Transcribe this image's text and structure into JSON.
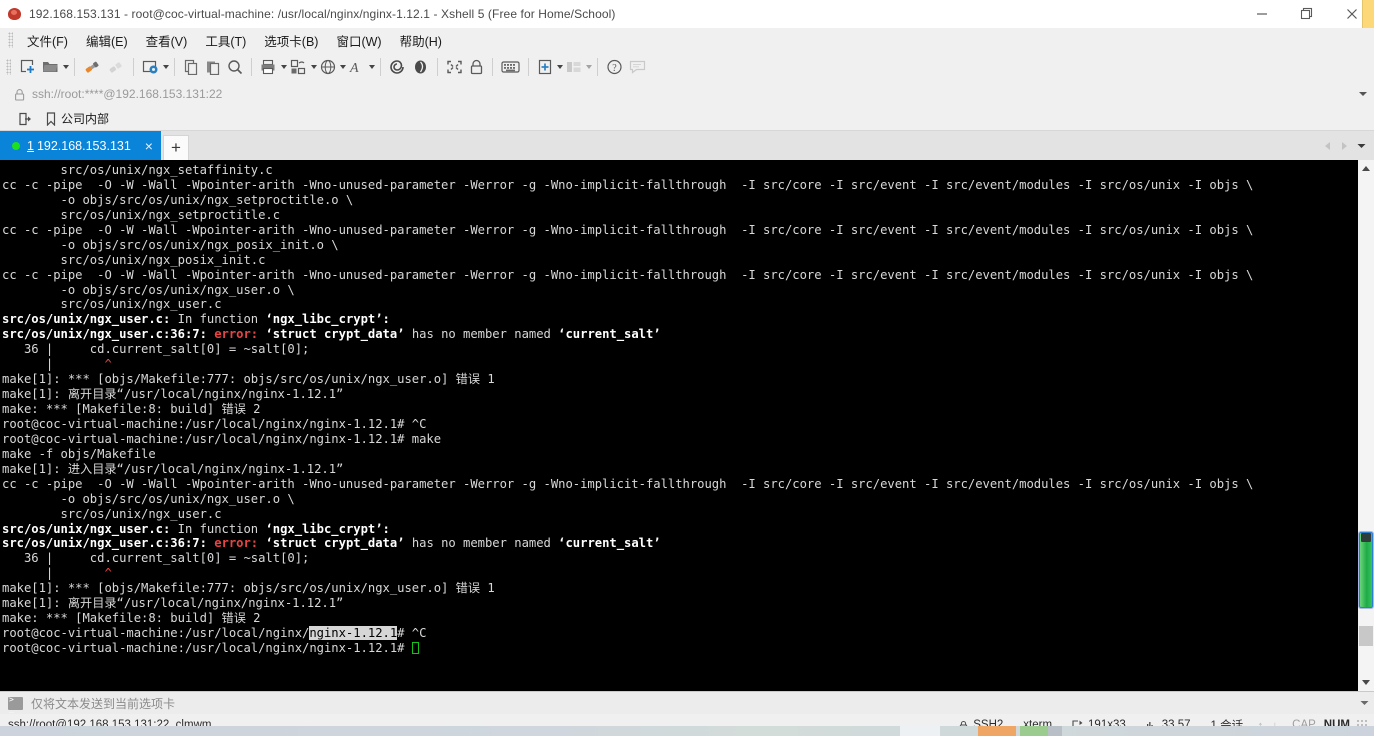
{
  "window": {
    "title": "192.168.153.131 - root@coc-virtual-machine: /usr/local/nginx/nginx-1.12.1 - Xshell 5 (Free for Home/School)",
    "minimize_label": "minimize",
    "restore_label": "restore",
    "close_label": "close"
  },
  "menubar": {
    "items": [
      {
        "label": "文件(F)",
        "name": "menu-file"
      },
      {
        "label": "编辑(E)",
        "name": "menu-edit"
      },
      {
        "label": "查看(V)",
        "name": "menu-view"
      },
      {
        "label": "工具(T)",
        "name": "menu-tools"
      },
      {
        "label": "选项卡(B)",
        "name": "menu-tab"
      },
      {
        "label": "窗口(W)",
        "name": "menu-window"
      },
      {
        "label": "帮助(H)",
        "name": "menu-help"
      }
    ]
  },
  "toolbar": {
    "icons": [
      "new-session-icon",
      "open-folder-icon",
      "connect-icon",
      "disconnect-icon",
      "session-properties-icon",
      "copy-icon",
      "paste-icon",
      "find-icon",
      "print-icon",
      "transfer-icon",
      "globe-icon",
      "font-icon",
      "log-icon",
      "compose-icon",
      "fullscreen-icon",
      "lock-icon",
      "keyboard-icon",
      "add-layout-icon",
      "arrange-icon",
      "help-icon",
      "chat-icon"
    ]
  },
  "address": {
    "value": "ssh://root:****@192.168.153.131:22",
    "lock_icon": "lock-icon",
    "dropdown_icon": "chevron-down-icon"
  },
  "bookmarks": {
    "export_icon": "export-icon",
    "bookmark_icon": "bookmark-icon",
    "label": "公司内部"
  },
  "tabs": {
    "items": [
      {
        "index": "1",
        "label": "192.168.153.131",
        "status": "connected",
        "close": "×"
      }
    ],
    "new_tab_label": "+",
    "nav_prev": "prev-tab",
    "nav_next": "next-tab",
    "nav_list": "tab-list"
  },
  "terminal": {
    "cursor_glyph": "",
    "lines": [
      [
        {
          "t": "        src/os/unix/ngx_setaffinity.c"
        }
      ],
      [
        {
          "t": "cc -c -pipe  -O -W -Wall -Wpointer-arith -Wno-unused-parameter -Werror -g -Wno-implicit-fallthrough  -I src/core -I src/event -I src/event/modules -I src/os/unix -I objs \\"
        }
      ],
      [
        {
          "t": "        -o objs/src/os/unix/ngx_setproctitle.o \\"
        }
      ],
      [
        {
          "t": "        src/os/unix/ngx_setproctitle.c"
        }
      ],
      [
        {
          "t": "cc -c -pipe  -O -W -Wall -Wpointer-arith -Wno-unused-parameter -Werror -g -Wno-implicit-fallthrough  -I src/core -I src/event -I src/event/modules -I src/os/unix -I objs \\"
        }
      ],
      [
        {
          "t": "        -o objs/src/os/unix/ngx_posix_init.o \\"
        }
      ],
      [
        {
          "t": "        src/os/unix/ngx_posix_init.c"
        }
      ],
      [
        {
          "t": "cc -c -pipe  -O -W -Wall -Wpointer-arith -Wno-unused-parameter -Werror -g -Wno-implicit-fallthrough  -I src/core -I src/event -I src/event/modules -I src/os/unix -I objs \\"
        }
      ],
      [
        {
          "t": "        -o objs/src/os/unix/ngx_user.o \\"
        }
      ],
      [
        {
          "t": "        src/os/unix/ngx_user.c"
        }
      ],
      [
        {
          "t": "src/os/unix/ngx_user.c:",
          "c": "b"
        },
        {
          "t": " In function "
        },
        {
          "t": "‘ngx_libc_crypt’:",
          "c": "b"
        }
      ],
      [
        {
          "t": "src/os/unix/ngx_user.c:36:7: ",
          "c": "b"
        },
        {
          "t": "error:",
          "c": "red"
        },
        {
          "t": " "
        },
        {
          "t": "‘struct crypt_data’",
          "c": "b"
        },
        {
          "t": " has no member named "
        },
        {
          "t": "‘current_salt’",
          "c": "b"
        }
      ],
      [
        {
          "t": "   36 |     cd.current_salt[0] = ~salt[0];"
        }
      ],
      [
        {
          "t": "      |       "
        },
        {
          "t": "^",
          "c": "redcaret"
        }
      ],
      [
        {
          "t": "make[1]: *** [objs/Makefile:777: objs/src/os/unix/ngx_user.o] 错误 1"
        }
      ],
      [
        {
          "t": "make[1]: 离开目录“/usr/local/nginx/nginx-1.12.1”"
        }
      ],
      [
        {
          "t": "make: *** [Makefile:8: build] 错误 2"
        }
      ],
      [
        {
          "t": "root@coc-virtual-machine:/usr/local/nginx/nginx-1.12.1# ^C"
        }
      ],
      [
        {
          "t": "root@coc-virtual-machine:/usr/local/nginx/nginx-1.12.1# make"
        }
      ],
      [
        {
          "t": "make -f objs/Makefile"
        }
      ],
      [
        {
          "t": "make[1]: 进入目录“/usr/local/nginx/nginx-1.12.1”"
        }
      ],
      [
        {
          "t": "cc -c -pipe  -O -W -Wall -Wpointer-arith -Wno-unused-parameter -Werror -g -Wno-implicit-fallthrough  -I src/core -I src/event -I src/event/modules -I src/os/unix -I objs \\"
        }
      ],
      [
        {
          "t": "        -o objs/src/os/unix/ngx_user.o \\"
        }
      ],
      [
        {
          "t": "        src/os/unix/ngx_user.c"
        }
      ],
      [
        {
          "t": "src/os/unix/ngx_user.c:",
          "c": "b"
        },
        {
          "t": " In function "
        },
        {
          "t": "‘ngx_libc_crypt’:",
          "c": "b"
        }
      ],
      [
        {
          "t": "src/os/unix/ngx_user.c:36:7: ",
          "c": "b"
        },
        {
          "t": "error:",
          "c": "red"
        },
        {
          "t": " "
        },
        {
          "t": "‘struct crypt_data’",
          "c": "b"
        },
        {
          "t": " has no member named "
        },
        {
          "t": "‘current_salt’",
          "c": "b"
        }
      ],
      [
        {
          "t": "   36 |     cd.current_salt[0] = ~salt[0];"
        }
      ],
      [
        {
          "t": "      |       "
        },
        {
          "t": "^",
          "c": "redcaret"
        }
      ],
      [
        {
          "t": "make[1]: *** [objs/Makefile:777: objs/src/os/unix/ngx_user.o] 错误 1"
        }
      ],
      [
        {
          "t": "make[1]: 离开目录“/usr/local/nginx/nginx-1.12.1”"
        }
      ],
      [
        {
          "t": "make: *** [Makefile:8: build] 错误 2"
        }
      ],
      [
        {
          "t": "root@coc-virtual-machine:/usr/local/nginx/"
        },
        {
          "t": "nginx-1.12.1",
          "c": "sel"
        },
        {
          "t": "# ^C"
        }
      ],
      [
        {
          "t": "root@coc-virtual-machine:/usr/local/nginx/nginx-1.12.1# "
        },
        {
          "cursor": true
        }
      ]
    ]
  },
  "sendbar": {
    "icon": "terminal-icon",
    "label": "仅将文本发送到当前选项卡",
    "dropdown_icon": "chevron-down-icon"
  },
  "statusbar": {
    "connection": "ssh://root@192.168.153.131:22, clmwm",
    "security_icon": "lock-icon",
    "protocol": "SSH2",
    "term_type": "xterm",
    "size_icon": "resize-icon",
    "size": "191x33",
    "pos_icon": "cursor-pos-icon",
    "position": "33,57",
    "sessions": "1 会话",
    "arrow_up": "↑",
    "arrow_down": "↓",
    "cap": "CAP",
    "num": "NUM"
  },
  "colors": {
    "accent": "#0a84d8",
    "terminal_bg": "#000000",
    "terminal_fg": "#d8d8d8",
    "error_red": "#e84444",
    "scroll_thumb": "#1faa46",
    "tab_dot": "#1de01d",
    "cursor": "#17c217"
  }
}
